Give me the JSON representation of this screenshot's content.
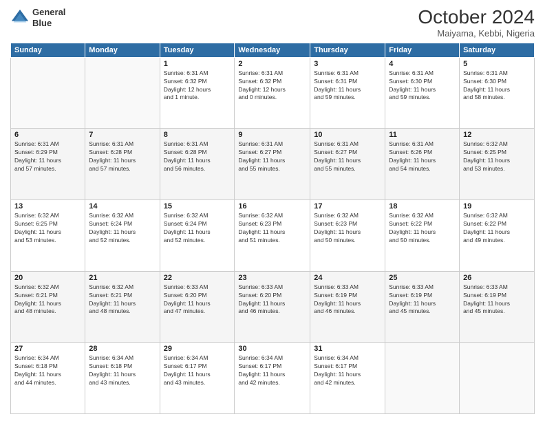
{
  "header": {
    "logo_line1": "General",
    "logo_line2": "Blue",
    "month": "October 2024",
    "location": "Maiyama, Kebbi, Nigeria"
  },
  "weekdays": [
    "Sunday",
    "Monday",
    "Tuesday",
    "Wednesday",
    "Thursday",
    "Friday",
    "Saturday"
  ],
  "weeks": [
    [
      {
        "day": "",
        "info": ""
      },
      {
        "day": "",
        "info": ""
      },
      {
        "day": "1",
        "info": "Sunrise: 6:31 AM\nSunset: 6:32 PM\nDaylight: 12 hours\nand 1 minute."
      },
      {
        "day": "2",
        "info": "Sunrise: 6:31 AM\nSunset: 6:32 PM\nDaylight: 12 hours\nand 0 minutes."
      },
      {
        "day": "3",
        "info": "Sunrise: 6:31 AM\nSunset: 6:31 PM\nDaylight: 11 hours\nand 59 minutes."
      },
      {
        "day": "4",
        "info": "Sunrise: 6:31 AM\nSunset: 6:30 PM\nDaylight: 11 hours\nand 59 minutes."
      },
      {
        "day": "5",
        "info": "Sunrise: 6:31 AM\nSunset: 6:30 PM\nDaylight: 11 hours\nand 58 minutes."
      }
    ],
    [
      {
        "day": "6",
        "info": "Sunrise: 6:31 AM\nSunset: 6:29 PM\nDaylight: 11 hours\nand 57 minutes."
      },
      {
        "day": "7",
        "info": "Sunrise: 6:31 AM\nSunset: 6:28 PM\nDaylight: 11 hours\nand 57 minutes."
      },
      {
        "day": "8",
        "info": "Sunrise: 6:31 AM\nSunset: 6:28 PM\nDaylight: 11 hours\nand 56 minutes."
      },
      {
        "day": "9",
        "info": "Sunrise: 6:31 AM\nSunset: 6:27 PM\nDaylight: 11 hours\nand 55 minutes."
      },
      {
        "day": "10",
        "info": "Sunrise: 6:31 AM\nSunset: 6:27 PM\nDaylight: 11 hours\nand 55 minutes."
      },
      {
        "day": "11",
        "info": "Sunrise: 6:31 AM\nSunset: 6:26 PM\nDaylight: 11 hours\nand 54 minutes."
      },
      {
        "day": "12",
        "info": "Sunrise: 6:32 AM\nSunset: 6:25 PM\nDaylight: 11 hours\nand 53 minutes."
      }
    ],
    [
      {
        "day": "13",
        "info": "Sunrise: 6:32 AM\nSunset: 6:25 PM\nDaylight: 11 hours\nand 53 minutes."
      },
      {
        "day": "14",
        "info": "Sunrise: 6:32 AM\nSunset: 6:24 PM\nDaylight: 11 hours\nand 52 minutes."
      },
      {
        "day": "15",
        "info": "Sunrise: 6:32 AM\nSunset: 6:24 PM\nDaylight: 11 hours\nand 52 minutes."
      },
      {
        "day": "16",
        "info": "Sunrise: 6:32 AM\nSunset: 6:23 PM\nDaylight: 11 hours\nand 51 minutes."
      },
      {
        "day": "17",
        "info": "Sunrise: 6:32 AM\nSunset: 6:23 PM\nDaylight: 11 hours\nand 50 minutes."
      },
      {
        "day": "18",
        "info": "Sunrise: 6:32 AM\nSunset: 6:22 PM\nDaylight: 11 hours\nand 50 minutes."
      },
      {
        "day": "19",
        "info": "Sunrise: 6:32 AM\nSunset: 6:22 PM\nDaylight: 11 hours\nand 49 minutes."
      }
    ],
    [
      {
        "day": "20",
        "info": "Sunrise: 6:32 AM\nSunset: 6:21 PM\nDaylight: 11 hours\nand 48 minutes."
      },
      {
        "day": "21",
        "info": "Sunrise: 6:32 AM\nSunset: 6:21 PM\nDaylight: 11 hours\nand 48 minutes."
      },
      {
        "day": "22",
        "info": "Sunrise: 6:33 AM\nSunset: 6:20 PM\nDaylight: 11 hours\nand 47 minutes."
      },
      {
        "day": "23",
        "info": "Sunrise: 6:33 AM\nSunset: 6:20 PM\nDaylight: 11 hours\nand 46 minutes."
      },
      {
        "day": "24",
        "info": "Sunrise: 6:33 AM\nSunset: 6:19 PM\nDaylight: 11 hours\nand 46 minutes."
      },
      {
        "day": "25",
        "info": "Sunrise: 6:33 AM\nSunset: 6:19 PM\nDaylight: 11 hours\nand 45 minutes."
      },
      {
        "day": "26",
        "info": "Sunrise: 6:33 AM\nSunset: 6:19 PM\nDaylight: 11 hours\nand 45 minutes."
      }
    ],
    [
      {
        "day": "27",
        "info": "Sunrise: 6:34 AM\nSunset: 6:18 PM\nDaylight: 11 hours\nand 44 minutes."
      },
      {
        "day": "28",
        "info": "Sunrise: 6:34 AM\nSunset: 6:18 PM\nDaylight: 11 hours\nand 43 minutes."
      },
      {
        "day": "29",
        "info": "Sunrise: 6:34 AM\nSunset: 6:17 PM\nDaylight: 11 hours\nand 43 minutes."
      },
      {
        "day": "30",
        "info": "Sunrise: 6:34 AM\nSunset: 6:17 PM\nDaylight: 11 hours\nand 42 minutes."
      },
      {
        "day": "31",
        "info": "Sunrise: 6:34 AM\nSunset: 6:17 PM\nDaylight: 11 hours\nand 42 minutes."
      },
      {
        "day": "",
        "info": ""
      },
      {
        "day": "",
        "info": ""
      }
    ]
  ]
}
